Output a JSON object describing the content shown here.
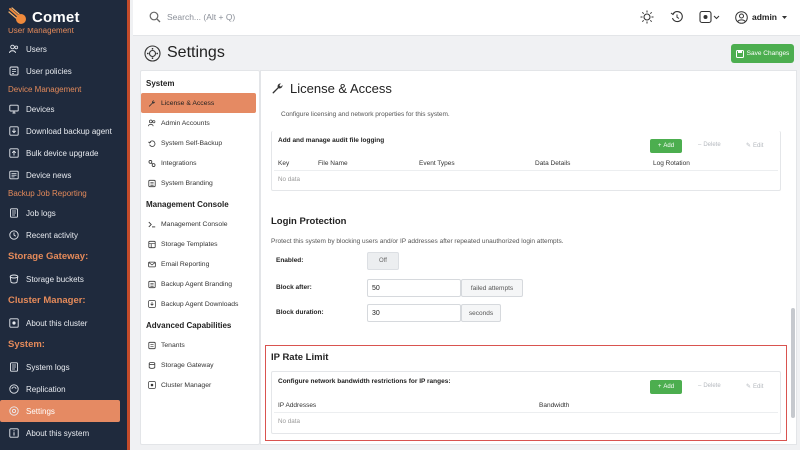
{
  "brand": {
    "name": "Comet"
  },
  "nav": {
    "cut_label": "User Management",
    "items": [
      {
        "type": "item",
        "label": "Users",
        "icon": "users-icon"
      },
      {
        "type": "item",
        "label": "User policies",
        "icon": "policy-icon"
      },
      {
        "type": "section",
        "label": "Device Management"
      },
      {
        "type": "item",
        "label": "Devices",
        "icon": "monitor-icon"
      },
      {
        "type": "item",
        "label": "Download backup agent",
        "icon": "download-icon"
      },
      {
        "type": "item",
        "label": "Bulk device upgrade",
        "icon": "upgrade-icon"
      },
      {
        "type": "item",
        "label": "Device news",
        "icon": "news-icon"
      },
      {
        "type": "section",
        "label": "Backup Job Reporting"
      },
      {
        "type": "item",
        "label": "Job logs",
        "icon": "log-icon"
      },
      {
        "type": "item",
        "label": "Recent activity",
        "icon": "clock-icon"
      },
      {
        "type": "section-big",
        "label": "Storage Gateway:"
      },
      {
        "type": "item",
        "label": "Storage buckets",
        "icon": "bucket-icon"
      },
      {
        "type": "section-big",
        "label": "Cluster Manager:"
      },
      {
        "type": "item",
        "label": "About this cluster",
        "icon": "cluster-icon"
      },
      {
        "type": "section-big",
        "label": "System:"
      },
      {
        "type": "item",
        "label": "System logs",
        "icon": "log-icon"
      },
      {
        "type": "item",
        "label": "Replication",
        "icon": "replication-icon"
      },
      {
        "type": "item",
        "label": "Settings",
        "icon": "gear-icon",
        "active": true
      },
      {
        "type": "item",
        "label": "About this system",
        "icon": "info-icon"
      }
    ]
  },
  "topbar": {
    "search_placeholder": "Search... (Alt + Q)",
    "user": "admin"
  },
  "page": {
    "title": "Settings",
    "save_label": "Save Changes"
  },
  "settings_nav": {
    "sections": [
      {
        "title": "System",
        "items": [
          {
            "label": "License & Access",
            "icon": "wrench-icon",
            "active": true
          },
          {
            "label": "Admin Accounts",
            "icon": "users-icon"
          },
          {
            "label": "System Self-Backup",
            "icon": "backup-icon"
          },
          {
            "label": "Integrations",
            "icon": "integration-icon"
          },
          {
            "label": "System Branding",
            "icon": "branding-icon"
          }
        ]
      },
      {
        "title": "Management Console",
        "items": [
          {
            "label": "Management Console",
            "icon": "console-icon"
          },
          {
            "label": "Storage Templates",
            "icon": "template-icon"
          },
          {
            "label": "Email Reporting",
            "icon": "email-icon"
          },
          {
            "label": "Backup Agent Branding",
            "icon": "branding-icon"
          },
          {
            "label": "Backup Agent Downloads",
            "icon": "download-icon"
          }
        ]
      },
      {
        "title": "Advanced Capabilities",
        "items": [
          {
            "label": "Tenants",
            "icon": "tenants-icon"
          },
          {
            "label": "Storage Gateway",
            "icon": "gateway-icon"
          },
          {
            "label": "Cluster Manager",
            "icon": "cluster-icon"
          }
        ]
      }
    ]
  },
  "content": {
    "title": "License & Access",
    "description": "Configure licensing and network properties for this system.",
    "audit": {
      "label": "Add and manage audit file logging",
      "add": "Add",
      "delete": "Delete",
      "edit": "Edit",
      "columns": [
        "Key",
        "File Name",
        "Event Types",
        "Data Details",
        "Log Rotation"
      ],
      "empty": "No data"
    },
    "login": {
      "title": "Login Protection",
      "description": "Protect this system by blocking users and/or IP addresses after repeated unauthorized login attempts.",
      "enabled_label": "Enabled:",
      "toggle": "Off",
      "block_after_label": "Block after:",
      "block_after_value": "50",
      "block_after_unit": "failed attempts",
      "block_duration_label": "Block duration:",
      "block_duration_value": "30",
      "block_duration_unit": "seconds"
    },
    "rate": {
      "title": "IP Rate Limit",
      "label": "Configure network bandwidth restrictions for IP ranges:",
      "add": "Add",
      "delete": "Delete",
      "edit": "Edit",
      "columns": [
        "IP Addresses",
        "Bandwidth"
      ],
      "empty": "No data"
    }
  }
}
